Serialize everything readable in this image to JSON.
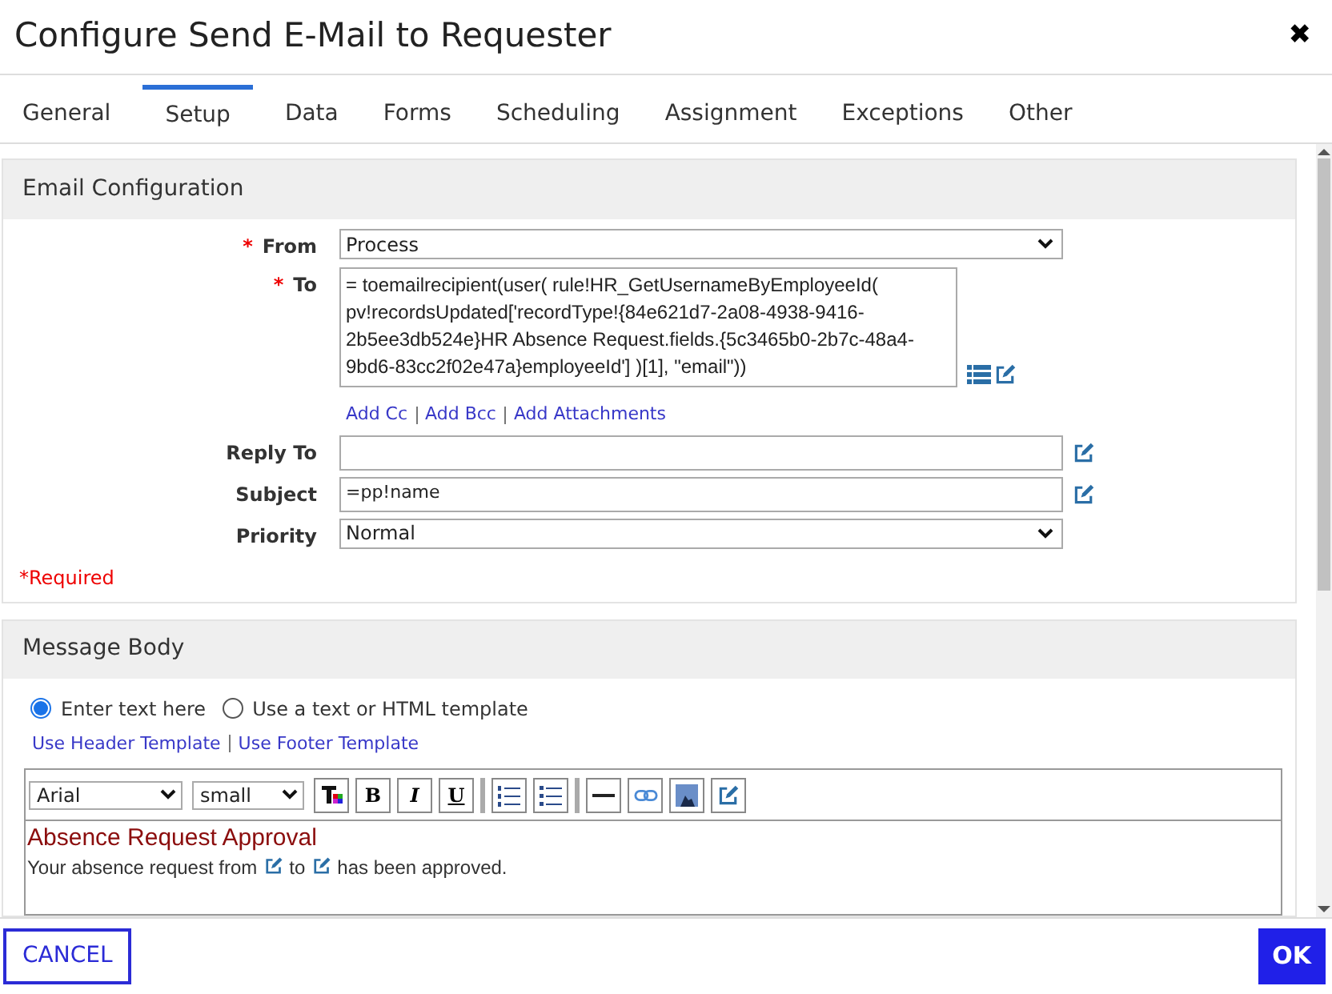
{
  "window": {
    "title": "Configure Send E-Mail to Requester",
    "close": "✖"
  },
  "tabs": [
    {
      "label": "General",
      "selected": false
    },
    {
      "label": "Setup",
      "selected": true
    },
    {
      "label": "Data",
      "selected": false
    },
    {
      "label": "Forms",
      "selected": false
    },
    {
      "label": "Scheduling",
      "selected": false
    },
    {
      "label": "Assignment",
      "selected": false
    },
    {
      "label": "Exceptions",
      "selected": false
    },
    {
      "label": "Other",
      "selected": false
    }
  ],
  "email_configuration": {
    "title": "Email Configuration",
    "fields": [
      {
        "kind": "select",
        "label": "From",
        "required_mark": "*",
        "value": "Process"
      },
      {
        "kind": "expression",
        "label": "To",
        "required_mark": "*",
        "value": "= toemailrecipient(user(  rule!HR_GetUsernameByEmployeeId( pv!recordsUpdated['recordType!{84e621d7-2a08-4938-9416-2b5ee3db524e}HR Absence Request.fields.{5c3465b0-2b7c-48a4-9bd6-83cc2f02e47a}employeeId']  )[1],  \"email\"))",
        "links": [
          "Add Cc",
          "Add Bcc",
          "Add Attachments"
        ]
      },
      {
        "kind": "text",
        "label": "Reply To"
      },
      {
        "kind": "text",
        "label": "Subject",
        "value": "=pp!name"
      },
      {
        "kind": "select",
        "label": "Priority",
        "value": "Normal"
      }
    ],
    "required_note": "*Required"
  },
  "message_body": {
    "title": "Message Body",
    "options": [
      {
        "label": "Enter text here",
        "selected": true
      },
      {
        "label": "Use a text or HTML template",
        "selected": false
      }
    ],
    "template_links": [
      "Use Header Template",
      "Use Footer Template"
    ],
    "editor": {
      "font": "Arial",
      "size": "small",
      "toolbar": [
        {
          "kind": "text-color"
        },
        {
          "kind": "bold",
          "label": "B"
        },
        {
          "kind": "italic",
          "label": "I"
        },
        {
          "kind": "underline",
          "label": "U"
        },
        {
          "kind": "separator"
        },
        {
          "kind": "ordered-list"
        },
        {
          "kind": "bullet-list"
        },
        {
          "kind": "separator"
        },
        {
          "kind": "rule"
        },
        {
          "kind": "link"
        },
        {
          "kind": "image"
        },
        {
          "kind": "edit"
        }
      ],
      "heading": "Absence Request Approval",
      "body": [
        {
          "kind": "text",
          "text": "Your absence request from"
        },
        {
          "kind": "field"
        },
        {
          "kind": "text",
          "text": "to"
        },
        {
          "kind": "field"
        },
        {
          "kind": "text",
          "text": "has been approved."
        }
      ]
    }
  },
  "footer": {
    "cancel": "CANCEL",
    "ok": "OK"
  }
}
